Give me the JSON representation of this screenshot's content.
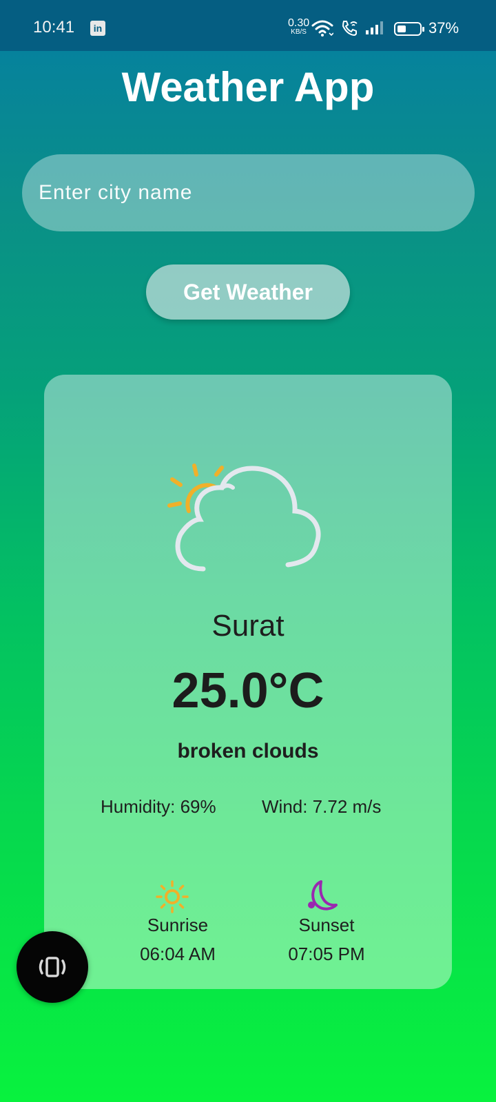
{
  "status_bar": {
    "time": "10:41",
    "notification_icon": "linkedin-icon",
    "notification_label": "in",
    "net_speed_value": "0.30",
    "net_speed_unit": "KB/S",
    "battery_percent": "37%",
    "battery_level": 0.37,
    "icons": [
      "wifi-icon",
      "wifi-call-icon",
      "signal-icon",
      "battery-icon"
    ]
  },
  "app": {
    "title": "Weather App"
  },
  "search": {
    "placeholder": "Enter city name",
    "value": "",
    "button_label": "Get Weather"
  },
  "weather": {
    "icon": "partly-cloudy-icon",
    "city": "Surat",
    "temperature": "25.0°C",
    "description": "broken clouds",
    "humidity": "Humidity: 69%",
    "wind": "Wind: 7.72 m/s",
    "sunrise_icon": "sun-icon",
    "sunrise_label": "Sunrise",
    "sunrise_time": "06:04 AM",
    "sunset_icon": "moon-icon",
    "sunset_label": "Sunset",
    "sunset_time": "07:05 PM"
  },
  "fab": {
    "icon": "screen-rotate-icon"
  },
  "colors": {
    "status_bar": "#055e82",
    "gradient_top": "#057ea3",
    "gradient_bottom": "#08f23e",
    "sun": "#f0b02a",
    "moon": "#9a27b0",
    "cloud": "#e3e8ee"
  }
}
